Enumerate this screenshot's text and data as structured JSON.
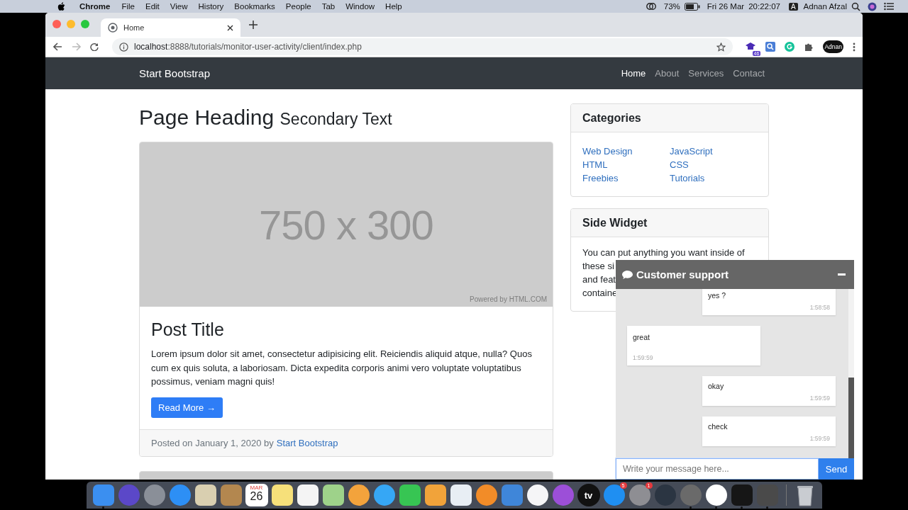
{
  "menubar": {
    "app": "Chrome",
    "menus": [
      "File",
      "Edit",
      "View",
      "History",
      "Bookmarks",
      "People",
      "Tab",
      "Window",
      "Help"
    ],
    "battery": "73%",
    "date": "Fri 26 Mar",
    "time": "20:22:07",
    "input_source": "A",
    "user": "Adnan Afzal"
  },
  "browser": {
    "tabs": [
      {
        "title": "Home",
        "selected": true
      }
    ],
    "url_host": "localhost",
    "url_path": ":8888/tutorials/monitor-user-activity/client/index.php",
    "extension_badge": "46",
    "profile": "Adnan"
  },
  "navbar": {
    "brand": "Start Bootstrap",
    "links": [
      {
        "label": "Home",
        "selected": true
      },
      {
        "label": "About",
        "selected": false
      },
      {
        "label": "Services",
        "selected": false
      },
      {
        "label": "Contact",
        "selected": false
      }
    ]
  },
  "page": {
    "heading": "Page Heading",
    "subheading": "Secondary Text"
  },
  "post": {
    "image": {
      "label": "750 x 300",
      "credit": "Powered by HTML.COM"
    },
    "title": "Post Title",
    "body": "Lorem ipsum dolor sit amet, consectetur adipisicing elit. Reiciendis aliquid atque, nulla? Quos cum ex quis soluta, a laboriosam. Dicta expedita corporis animi vero voluptate voluptatibus possimus, veniam magni quis!",
    "button": "Read More →",
    "footer_prefix": "Posted on January 1, 2020 by",
    "footer_link": "Start Bootstrap"
  },
  "categories": {
    "title": "Categories",
    "columns": [
      [
        "Web Design",
        "HTML",
        "Freebies"
      ],
      [
        "JavaScript",
        "CSS",
        "Tutorials"
      ]
    ]
  },
  "side_widget": {
    "title": "Side Widget",
    "lines": [
      "You can put anything you want inside of",
      "these si",
      "and feat",
      "containe"
    ]
  },
  "chat": {
    "title": "Customer support",
    "messages": [
      {
        "kind": "sent",
        "text": "yes ?",
        "time": "1:58:58"
      },
      {
        "kind": "received",
        "text": "great",
        "time": "1:59:59"
      },
      {
        "kind": "sent",
        "text": "okay",
        "time": "1:59:59"
      },
      {
        "kind": "sent",
        "text": "check",
        "time": "1:59:59"
      }
    ],
    "placeholder": "Write your message here...",
    "send": "Send"
  },
  "dock": {
    "apps": [
      {
        "kind": "square",
        "color": "#3b8ff0",
        "running": true
      },
      {
        "kind": "circle",
        "color": "#5b48c8",
        "running": false
      },
      {
        "kind": "circle",
        "color": "#8a8f98",
        "running": false
      },
      {
        "kind": "circle",
        "color": "#2d8ff5",
        "running": false
      },
      {
        "kind": "square",
        "color": "#d9cfb0",
        "running": false
      },
      {
        "kind": "square",
        "color": "#b3874f",
        "running": false
      },
      {
        "kind": "calendar",
        "month": "MAR",
        "day": "26",
        "running": false
      },
      {
        "kind": "square",
        "color": "#f6e07a",
        "running": false
      },
      {
        "kind": "square",
        "color": "#f4f4f4",
        "running": false
      },
      {
        "kind": "square",
        "color": "#9ed28a",
        "running": false
      },
      {
        "kind": "circle",
        "color": "#f3a33c",
        "running": false
      },
      {
        "kind": "circle",
        "color": "#36a7f5",
        "running": false
      },
      {
        "kind": "square",
        "color": "#37c553",
        "running": false
      },
      {
        "kind": "square",
        "color": "#f1a33a",
        "running": false
      },
      {
        "kind": "square",
        "color": "#e8eef4",
        "running": false
      },
      {
        "kind": "circle",
        "color": "#f28c28",
        "running": false
      },
      {
        "kind": "square",
        "color": "#3f86d9",
        "running": false
      },
      {
        "kind": "circle",
        "color": "#f5f5f7",
        "running": false
      },
      {
        "kind": "circle",
        "color": "#9c4fd8",
        "running": false
      },
      {
        "kind": "tv",
        "label": "tv",
        "running": false
      },
      {
        "kind": "circle",
        "color": "#1f8ff2",
        "running": false,
        "badge": "5"
      },
      {
        "kind": "circle",
        "color": "#8e8e93",
        "running": false,
        "badge": "1"
      },
      {
        "kind": "circle",
        "color": "#2b3542",
        "running": false
      },
      {
        "kind": "circle",
        "color": "#6a6a6a",
        "running": true
      },
      {
        "kind": "circle",
        "color": "#ffffff",
        "running": true
      },
      {
        "kind": "square",
        "color": "#161616",
        "running": true
      },
      {
        "kind": "square",
        "color": "#4a4a4a",
        "running": true
      },
      {
        "kind": "trash",
        "running": false
      }
    ]
  }
}
